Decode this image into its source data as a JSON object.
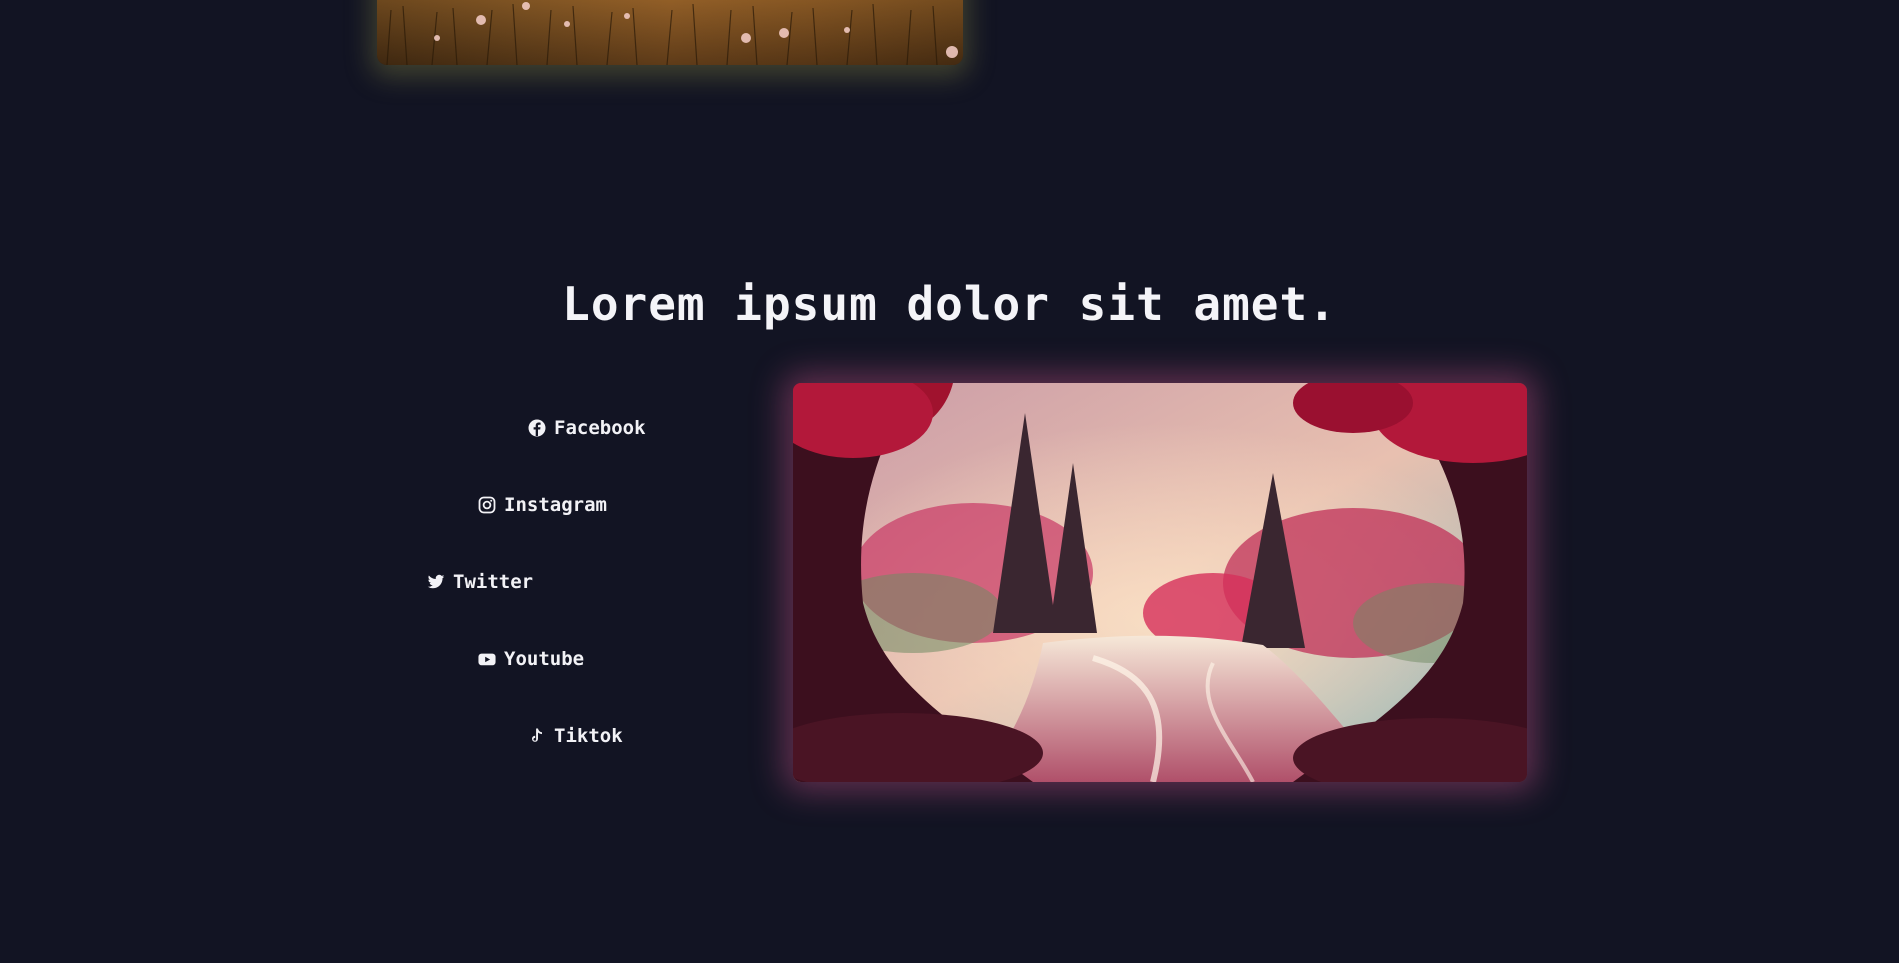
{
  "section": {
    "heading": "Lorem ipsum dolor sit amet."
  },
  "social_links": [
    {
      "label": "Facebook",
      "icon": "facebook-icon"
    },
    {
      "label": "Instagram",
      "icon": "instagram-icon"
    },
    {
      "label": "Twitter",
      "icon": "twitter-icon"
    },
    {
      "label": "Youtube",
      "icon": "youtube-icon"
    },
    {
      "label": "Tiktok",
      "icon": "tiktok-icon"
    }
  ],
  "colors": {
    "background": "#121423",
    "text": "#f2f2f6",
    "main_image_glow": "#be5082",
    "top_image_glow": "#969646"
  }
}
